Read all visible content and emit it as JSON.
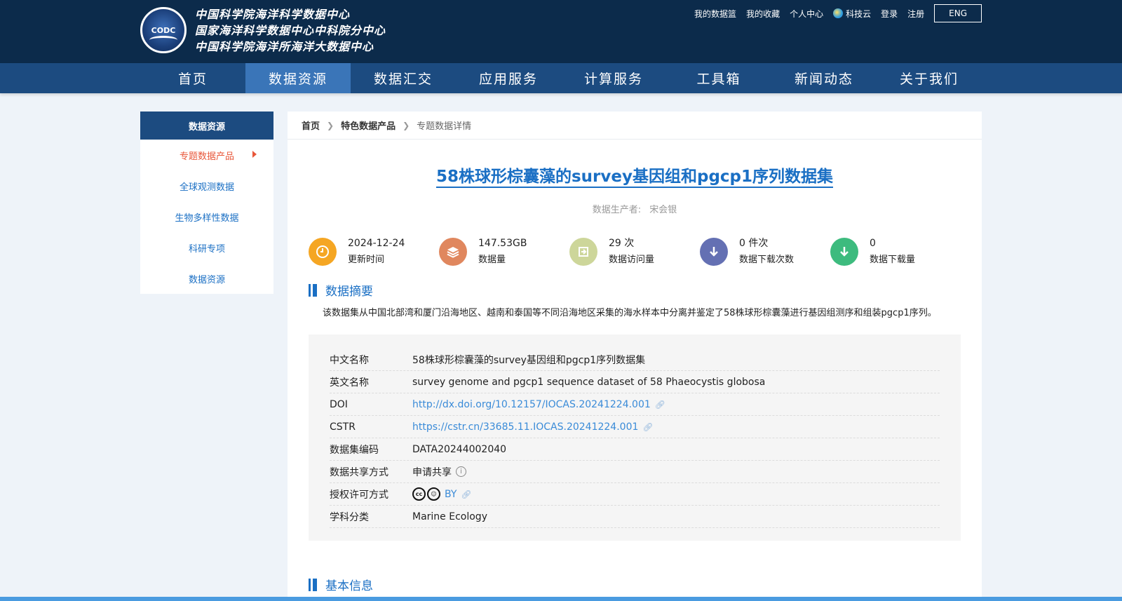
{
  "header": {
    "logo_abbr": "CODC",
    "logo_lines": [
      "中国科学院海洋科学数据中心",
      "国家海洋科学数据中心中科院分中心",
      "中国科学院海洋所海洋大数据中心"
    ],
    "top_links": [
      "我的数据篮",
      "我的收藏",
      "个人中心",
      "科技云",
      "登录",
      "注册"
    ],
    "lang_button": "ENG"
  },
  "nav": {
    "items": [
      "首页",
      "数据资源",
      "数据汇交",
      "应用服务",
      "计算服务",
      "工具箱",
      "新闻动态",
      "关于我们"
    ],
    "active_index": 1
  },
  "sidebar": {
    "title": "数据资源",
    "items": [
      "专题数据产品",
      "全球观测数据",
      "生物多样性数据",
      "科研专项",
      "数据资源"
    ]
  },
  "breadcrumb": [
    "首页",
    "特色数据产品",
    "专题数据详情"
  ],
  "dataset": {
    "title": "58株球形棕囊藻的survey基因组和pgcp1序列数据集",
    "producer_label": "数据生产者:",
    "producer_name": "宋会银"
  },
  "stats": [
    {
      "value": "2024-12-24",
      "label": "更新时间",
      "color": "#f5a623",
      "icon": "clock-icon"
    },
    {
      "value": "147.53GB",
      "label": "数据量",
      "color": "#e0875e",
      "icon": "layers-icon"
    },
    {
      "value": "29 次",
      "label": "数据访问量",
      "color": "#cdd69a",
      "icon": "enter-icon"
    },
    {
      "value": "0 件次",
      "label": "数据下载次数",
      "color": "#6470b3",
      "icon": "download-icon"
    },
    {
      "value": "0",
      "label": "数据下载量",
      "color": "#3dbb7e",
      "icon": "download-icon"
    }
  ],
  "abstract": {
    "heading": "数据摘要",
    "text": "该数据集从中国北部湾和厦门沿海地区、越南和泰国等不同沿海地区采集的海水样本中分离并鉴定了58株球形棕囊藻进行基因组测序和组装pgcp1序列。"
  },
  "info": {
    "cn_name_label": "中文名称",
    "cn_name": "58株球形棕囊藻的survey基因组和pgcp1序列数据集",
    "en_name_label": "英文名称",
    "en_name": "survey genome and pgcp1 sequence dataset of 58 Phaeocystis globosa",
    "doi_label": "DOI",
    "doi": "http://dx.doi.org/10.12157/IOCAS.20241224.001",
    "cstr_label": "CSTR",
    "cstr": "https://cstr.cn/33685.11.IOCAS.20241224.001",
    "code_label": "数据集编码",
    "code": "DATA20244002040",
    "share_label": "数据共享方式",
    "share": "申请共享",
    "license_label": "授权许可方式",
    "license": "BY",
    "subject_label": "学科分类",
    "subject": "Marine Ecology"
  },
  "basic_info": {
    "heading": "基本信息"
  }
}
